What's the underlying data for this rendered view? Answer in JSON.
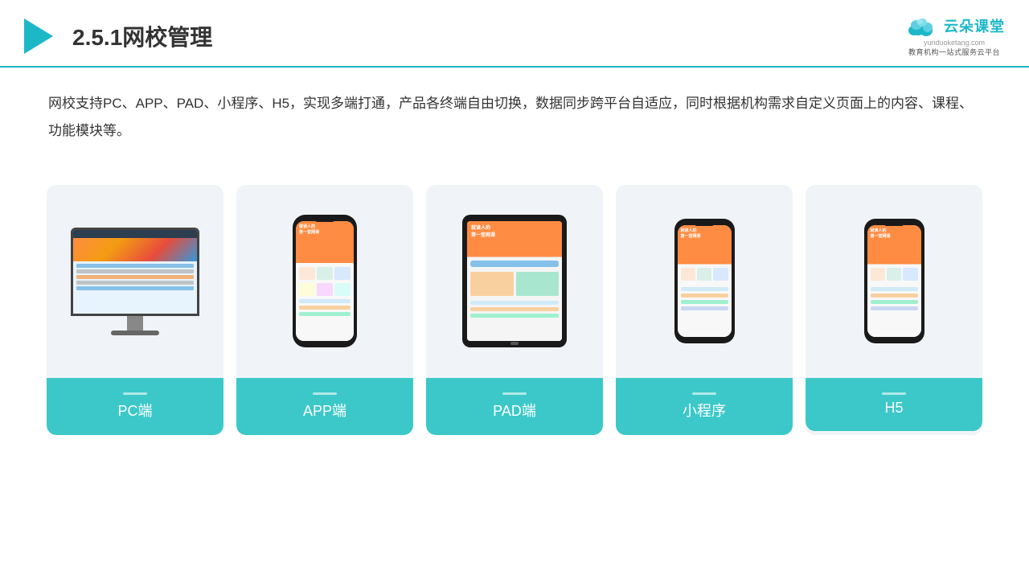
{
  "header": {
    "title": "2.5.1网校管理",
    "logo_main": "云朵课堂",
    "logo_domain": "yunduoketang.com",
    "logo_subtitle": "教育机构一站\n式服务云平台"
  },
  "description": {
    "text": "网校支持PC、APP、PAD、小程序、H5，实现多端打通，产品各终端自由切换，数据同步跨平台自适应，同时根据机构需求自定义页面上的内容、课程、功能模块等。"
  },
  "cards": [
    {
      "id": "pc",
      "label": "PC端",
      "device_type": "monitor"
    },
    {
      "id": "app",
      "label": "APP端",
      "device_type": "phone-tall"
    },
    {
      "id": "pad",
      "label": "PAD端",
      "device_type": "tablet"
    },
    {
      "id": "miniprogram",
      "label": "小程序",
      "device_type": "phone"
    },
    {
      "id": "h5",
      "label": "H5",
      "device_type": "phone"
    }
  ]
}
